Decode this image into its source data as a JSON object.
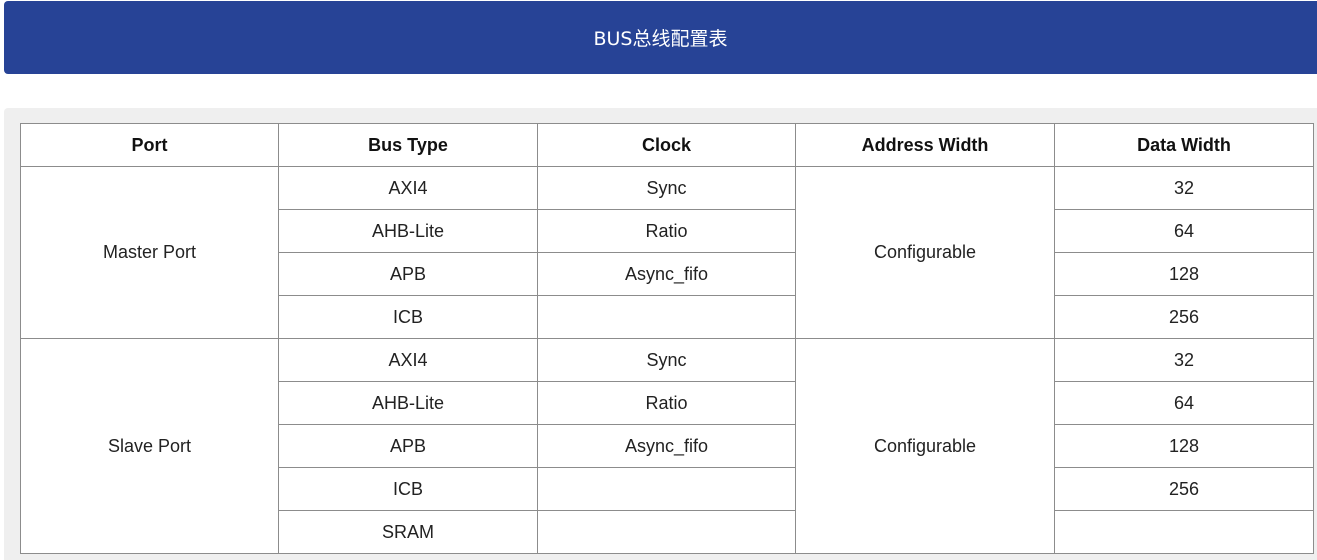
{
  "header": {
    "title": "BUS总线配置表"
  },
  "table": {
    "columns": [
      "Port",
      "Bus Type",
      "Clock",
      "Address Width",
      "Data Width"
    ],
    "groups": [
      {
        "port": "Master Port",
        "address_width": "Configurable",
        "rows": [
          {
            "bus_type": "AXI4",
            "clock": "Sync",
            "data_width": "32"
          },
          {
            "bus_type": "AHB-Lite",
            "clock": "Ratio",
            "data_width": "64"
          },
          {
            "bus_type": "APB",
            "clock": "Async_fifo",
            "data_width": "128"
          },
          {
            "bus_type": "ICB",
            "clock": "",
            "data_width": "256"
          }
        ]
      },
      {
        "port": "Slave Port",
        "address_width": "Configurable",
        "rows": [
          {
            "bus_type": "AXI4",
            "clock": "Sync",
            "data_width": "32"
          },
          {
            "bus_type": "AHB-Lite",
            "clock": "Ratio",
            "data_width": "64"
          },
          {
            "bus_type": "APB",
            "clock": "Async_fifo",
            "data_width": "128"
          },
          {
            "bus_type": "ICB",
            "clock": "",
            "data_width": "256"
          },
          {
            "bus_type": "SRAM",
            "clock": "",
            "data_width": ""
          }
        ]
      }
    ]
  }
}
